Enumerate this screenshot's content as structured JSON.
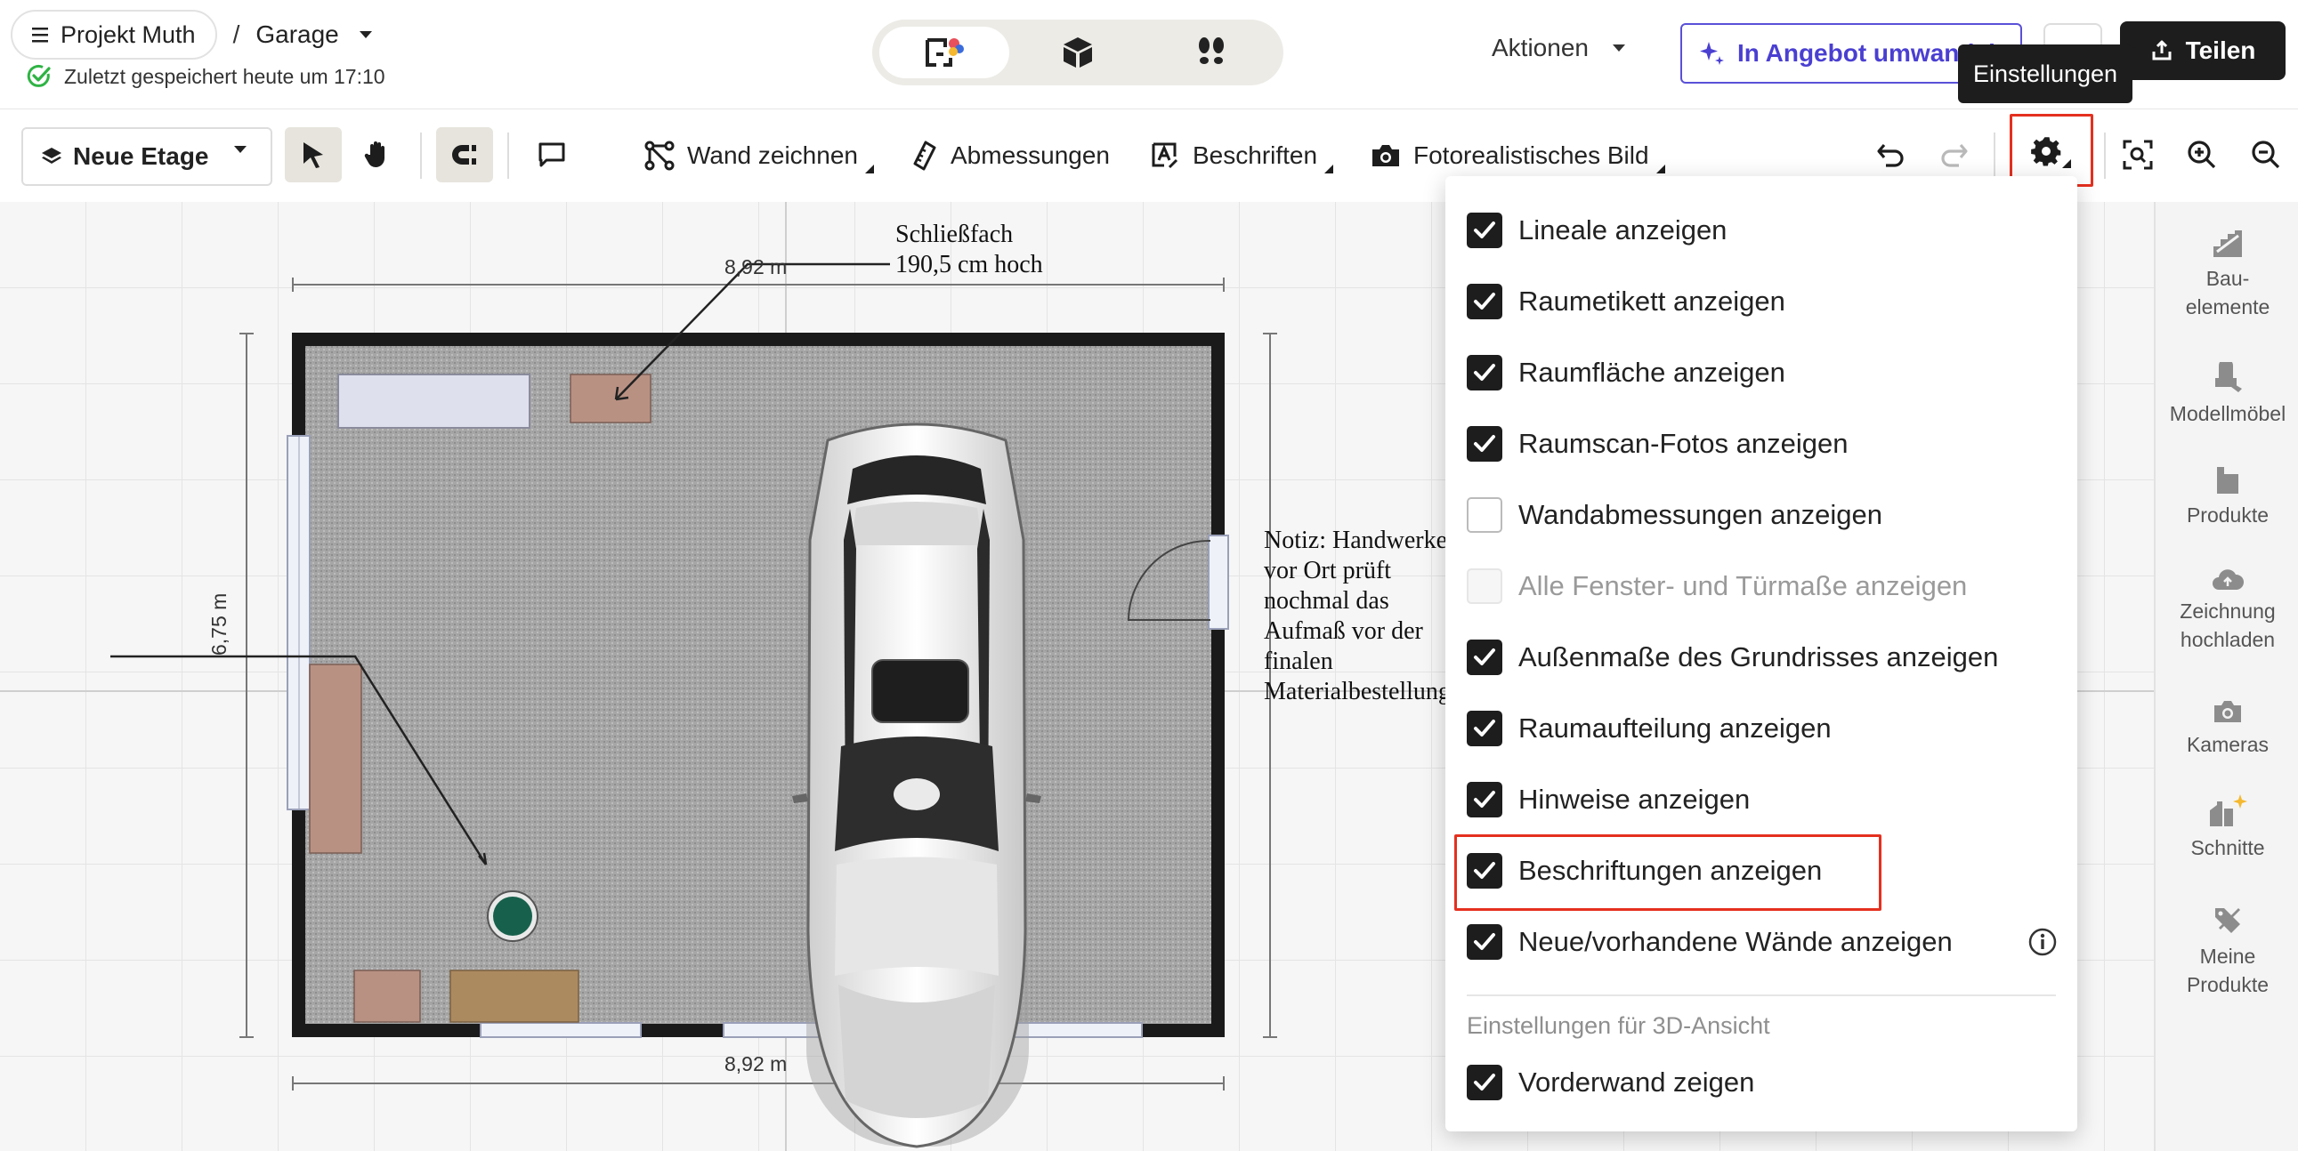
{
  "header": {
    "project_label": "Projekt Muth",
    "separator": "/",
    "floor_name": "Garage",
    "save_status": "Zuletzt gespeichert heute um 17:10",
    "actions_label": "Aktionen",
    "offer_label": "In Angebot umwandeln",
    "share_label": "Teilen",
    "tooltip": "Einstellungen"
  },
  "view_modes": [
    {
      "icon": "floorplan-2d-icon",
      "active": true
    },
    {
      "icon": "3d-box-icon",
      "active": false
    },
    {
      "icon": "walk-footsteps-icon",
      "active": false
    }
  ],
  "toolbar": {
    "floor_button": "Neue Etage",
    "draw_wall": "Wand zeichnen",
    "dimensions": "Abmessungen",
    "labels": "Beschriften",
    "photo": "Fotorealistisches Bild"
  },
  "canvas": {
    "dim_top": "8,92 m",
    "dim_bottom": "8,92 m",
    "dim_left": "6,75 m",
    "callout_locker_1": "Schließfach",
    "callout_locker_2": "190,5 cm hoch",
    "note_lines": [
      "Notiz: Handwerker",
      "vor Ort prüft",
      "nochmal das",
      "Aufmaß vor der",
      "finalen",
      "Materialbestellung"
    ]
  },
  "settings_menu": {
    "options": [
      {
        "label": "Lineale anzeigen",
        "state": "checked"
      },
      {
        "label": "Raumetikett anzeigen",
        "state": "checked"
      },
      {
        "label": "Raumfläche anzeigen",
        "state": "checked"
      },
      {
        "label": "Raumscan-Fotos anzeigen",
        "state": "checked"
      },
      {
        "label": "Wandabmessungen anzeigen",
        "state": "unchecked"
      },
      {
        "label": "Alle Fenster- und Türmaße anzeigen",
        "state": "disabled"
      },
      {
        "label": "Außenmaße des Grundrisses anzeigen",
        "state": "checked"
      },
      {
        "label": "Raumaufteilung anzeigen",
        "state": "checked"
      },
      {
        "label": "Hinweise anzeigen",
        "state": "checked"
      },
      {
        "label": "Beschriftungen anzeigen",
        "state": "checked"
      },
      {
        "label": "Neue/vorhandene Wände anzeigen",
        "state": "checked"
      }
    ],
    "section_3d_title": "Einstellungen für 3D-Ansicht",
    "option_3d": {
      "label": "Vorderwand zeigen",
      "state": "checked"
    }
  },
  "right_sidebar": [
    {
      "label": "Bau-\nelemente",
      "icon": "building-elements-icon"
    },
    {
      "label": "Modellmöbel",
      "icon": "model-furniture-icon"
    },
    {
      "label": "Produkte",
      "icon": "products-icon"
    },
    {
      "label": "Zeichnung\nhochladen",
      "icon": "upload-cloud-icon"
    },
    {
      "label": "Kameras",
      "icon": "camera-icon"
    },
    {
      "label": "Schnitte",
      "icon": "sections-icon"
    },
    {
      "label": "Meine\nProdukte",
      "icon": "my-products-icon"
    }
  ],
  "colors": {
    "accent_purple": "#4a3fd1",
    "highlight_red": "#e5301f",
    "dark": "#1d1d1d",
    "success_green": "#2fb344"
  }
}
